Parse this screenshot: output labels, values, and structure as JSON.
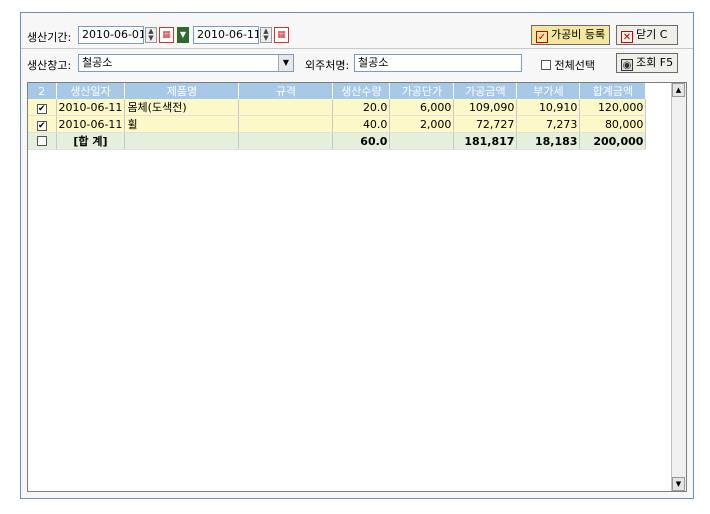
{
  "filter": {
    "period_label": "생산기간:",
    "date_from": "2010-06-01",
    "date_to": "2010-06-11",
    "warehouse_label": "생산창고:",
    "warehouse_value": "철공소",
    "vendor_label": "외주처명:",
    "vendor_value": "철공소",
    "select_all_label": "전체선택"
  },
  "buttons": {
    "register_label": "가공비 등록",
    "close_label": "닫기 C",
    "search_label": "조회 F5"
  },
  "table": {
    "header_count": "2",
    "columns": [
      "생산일자",
      "제품명",
      "규격",
      "생산수량",
      "가공단가",
      "가공금액",
      "부가세",
      "합계금액"
    ],
    "rows": [
      {
        "checked": "✔",
        "date": "2010-06-11",
        "product": "몸체(도색전)",
        "spec": "",
        "qty": "20.0",
        "unit_price": "6,000",
        "amount": "109,090",
        "vat": "10,910",
        "total": "120,000"
      },
      {
        "checked": "✔",
        "date": "2010-06-11",
        "product": "휠",
        "spec": "",
        "qty": "40.0",
        "unit_price": "2,000",
        "amount": "72,727",
        "vat": "7,273",
        "total": "80,000"
      }
    ],
    "total_row": {
      "label": "[합 계]",
      "qty": "60.0",
      "unit_price": "",
      "amount": "181,817",
      "vat": "18,183",
      "total": "200,000"
    }
  },
  "colors": {
    "header_bg": "#a8c8e8",
    "row_bg": "#fdf8c8",
    "total_bg": "#e4f0dc"
  }
}
